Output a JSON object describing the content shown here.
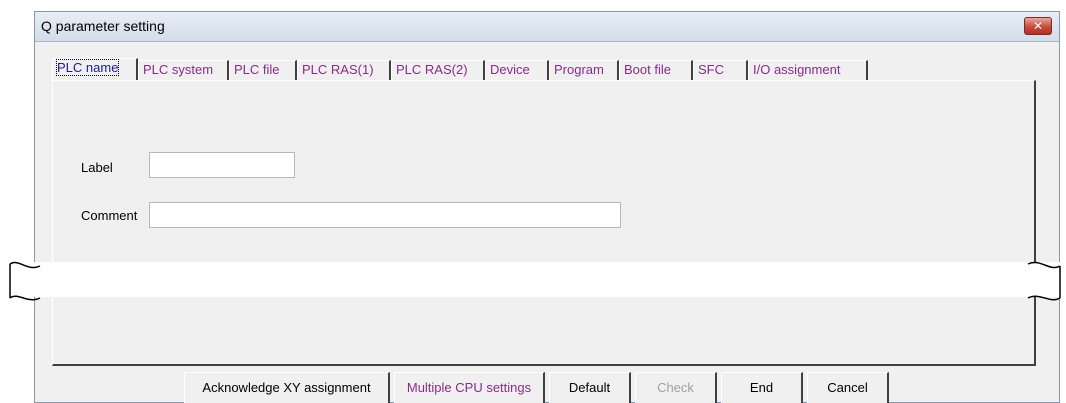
{
  "window": {
    "title": "Q parameter setting",
    "close_symbol": "✕"
  },
  "tabs": [
    {
      "label": "PLC name"
    },
    {
      "label": "PLC system"
    },
    {
      "label": "PLC file"
    },
    {
      "label": "PLC RAS(1)"
    },
    {
      "label": "PLC RAS(2)"
    },
    {
      "label": "Device"
    },
    {
      "label": "Program"
    },
    {
      "label": "Boot file"
    },
    {
      "label": "SFC"
    },
    {
      "label": "I/O assignment"
    }
  ],
  "form": {
    "label_caption": "Label",
    "label_value": "",
    "comment_caption": "Comment",
    "comment_value": ""
  },
  "buttons": {
    "ack_xy": "Acknowledge XY assignment",
    "multi_cpu": "Multiple CPU settings",
    "default": "Default",
    "check": "Check",
    "end": "End",
    "cancel": "Cancel"
  }
}
